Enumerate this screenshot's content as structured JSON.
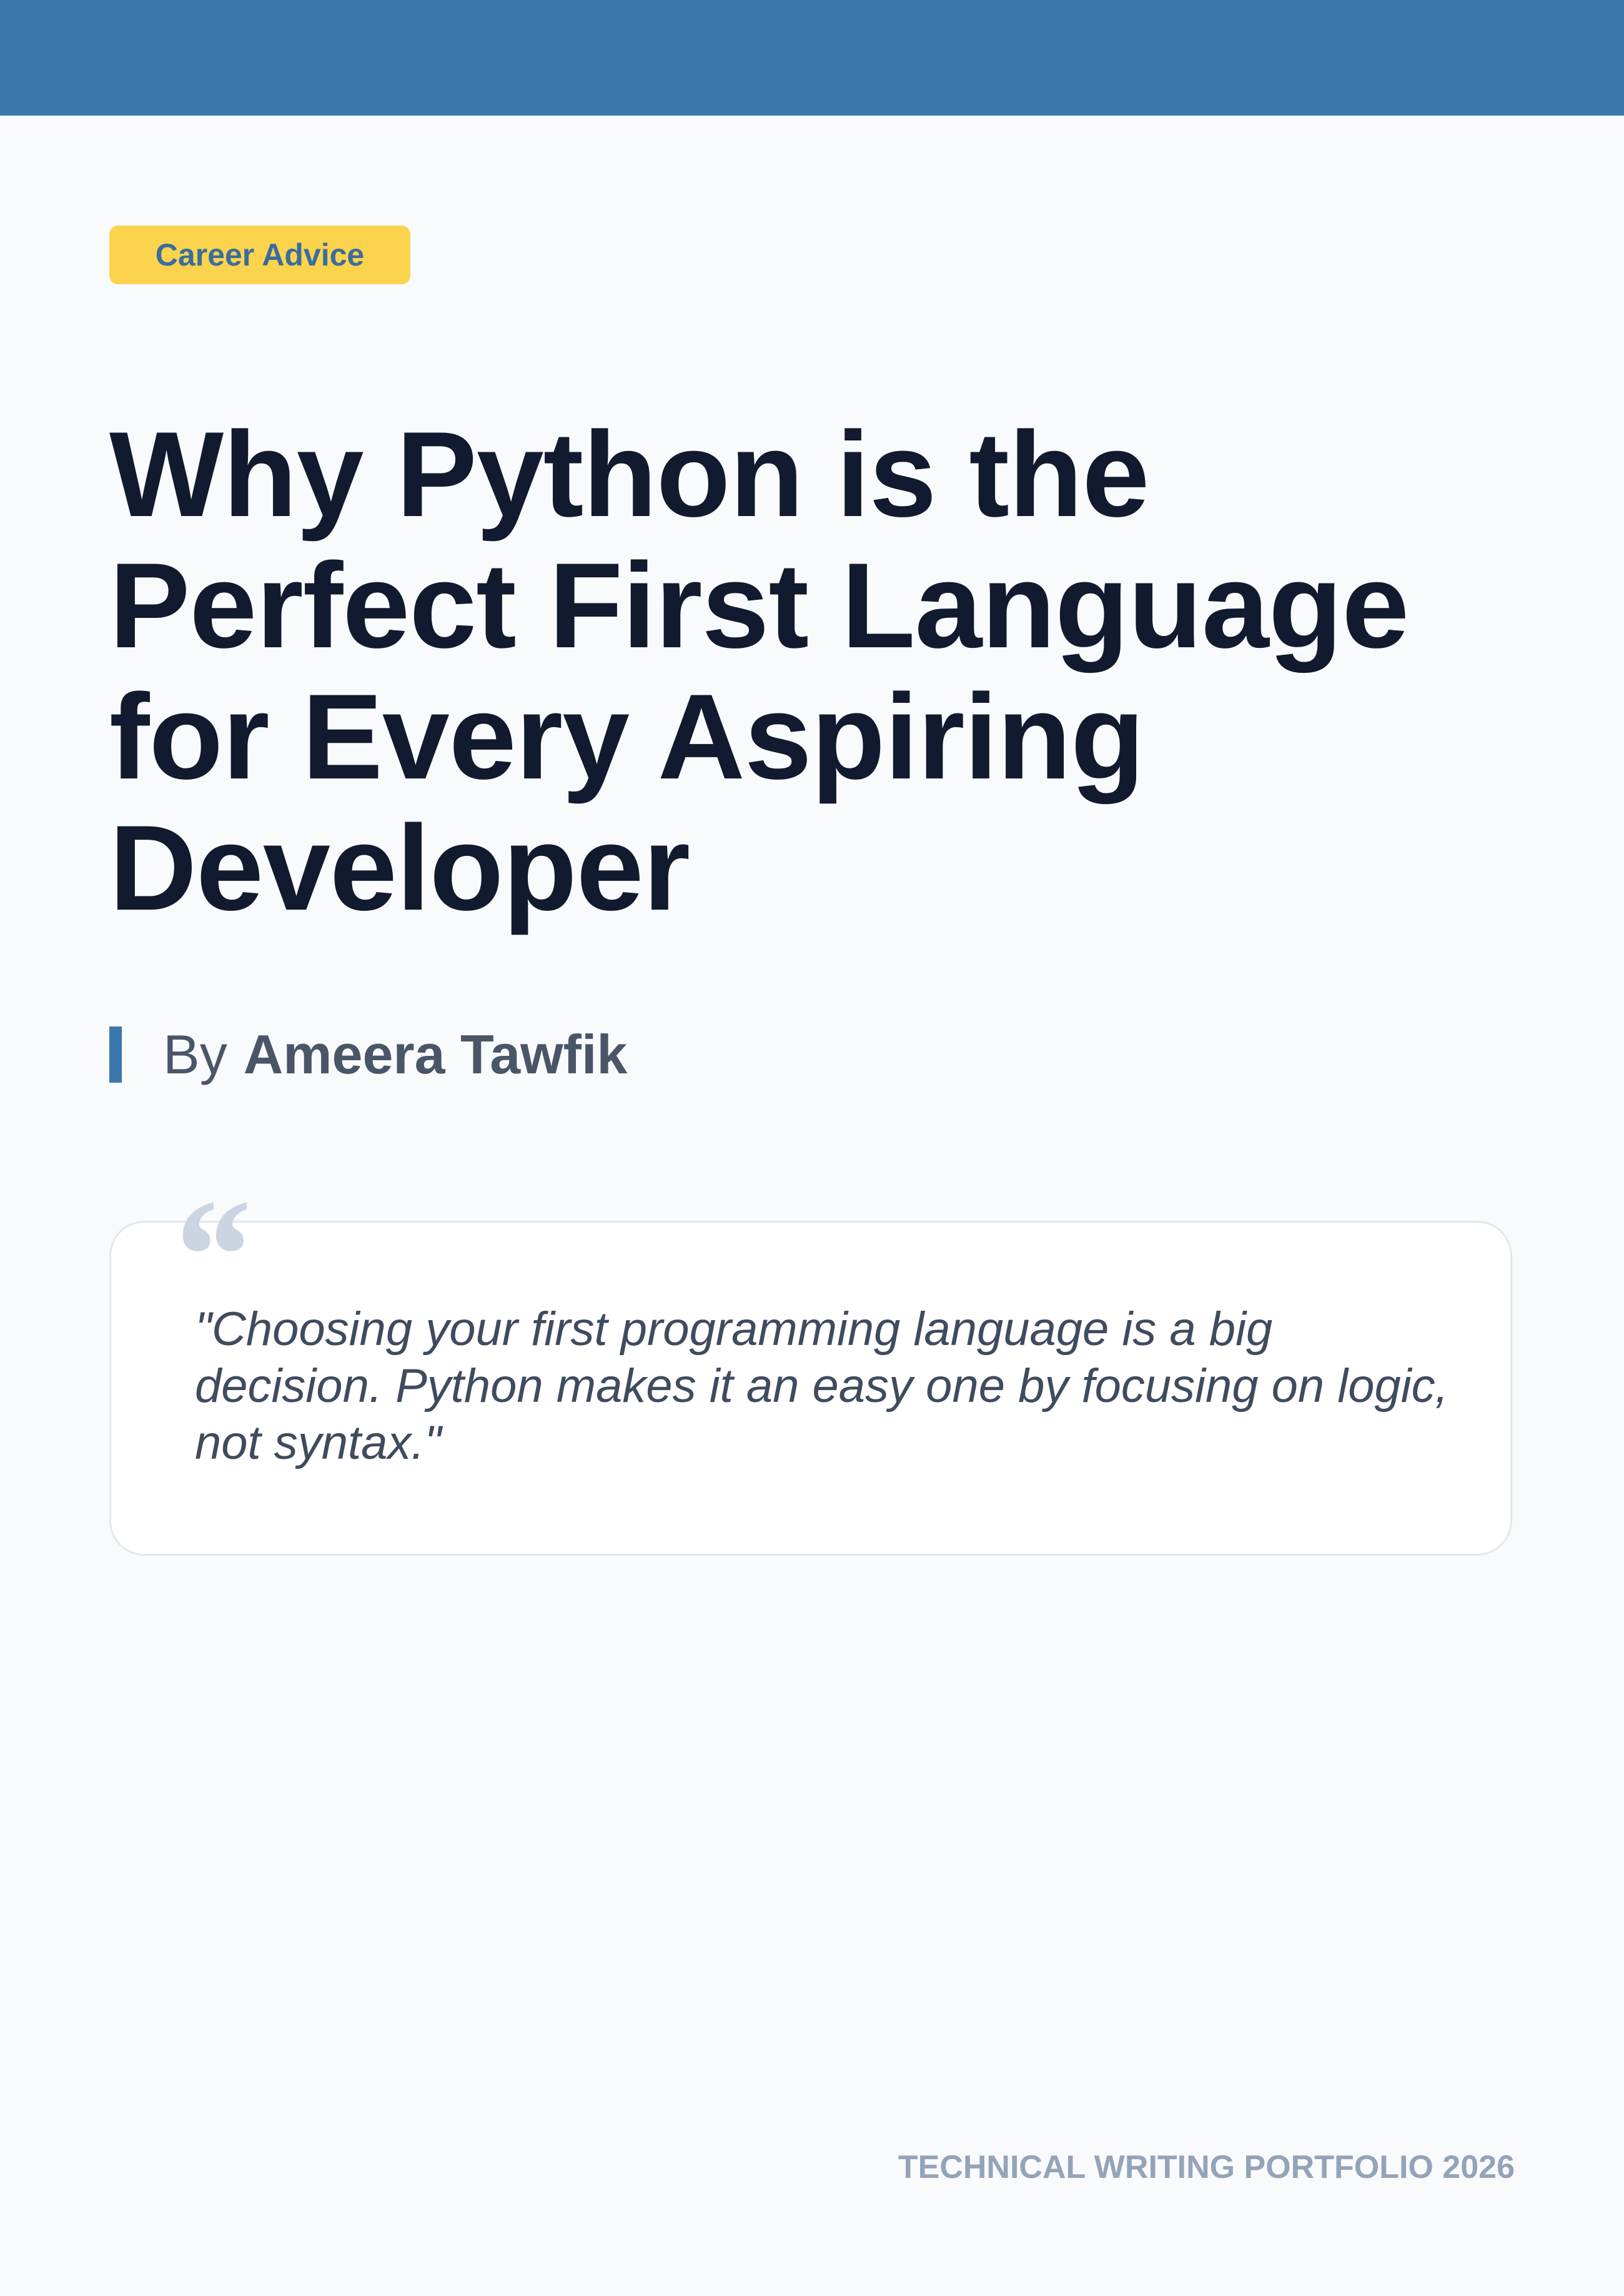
{
  "header": {
    "bar_color": "#3a78ac"
  },
  "article": {
    "category": "Career Advice",
    "title": "Why Python is the Perfect First Language for Every Aspiring Developer",
    "byline_prefix": "By",
    "author": "Ameera Tawfik"
  },
  "quote": {
    "mark": "“",
    "text": "\"Choosing your first programming language is a big decision. Python makes it an easy one by focusing on logic, not syntax.\""
  },
  "footer": {
    "label": "TECHNICAL WRITING PORTFOLIO 2026"
  },
  "colors": {
    "accent": "#3a78ac",
    "badge": "#fcd34d",
    "title": "#111a2e",
    "muted": "#94a3b8",
    "background": "#f8fafc"
  }
}
